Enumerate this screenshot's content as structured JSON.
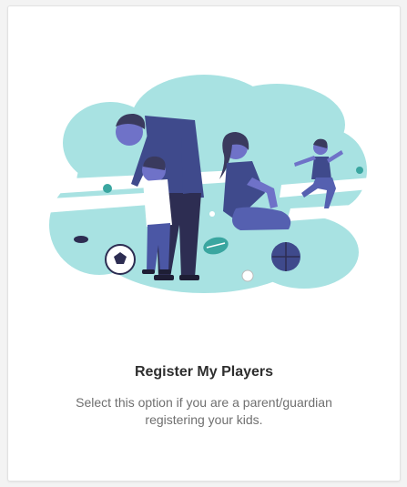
{
  "card": {
    "title": "Register My Players",
    "description": "Select this option if you are a parent/guardian registering your kids."
  },
  "illustration": {
    "subject": "family playing with sports balls",
    "colors": {
      "background_blob": "#a8e2e2",
      "skin": "#6f72c8",
      "hair": "#3a3a5e",
      "shirt_dark": "#3f4a8c",
      "pants_dark": "#2d2d52"
    }
  }
}
